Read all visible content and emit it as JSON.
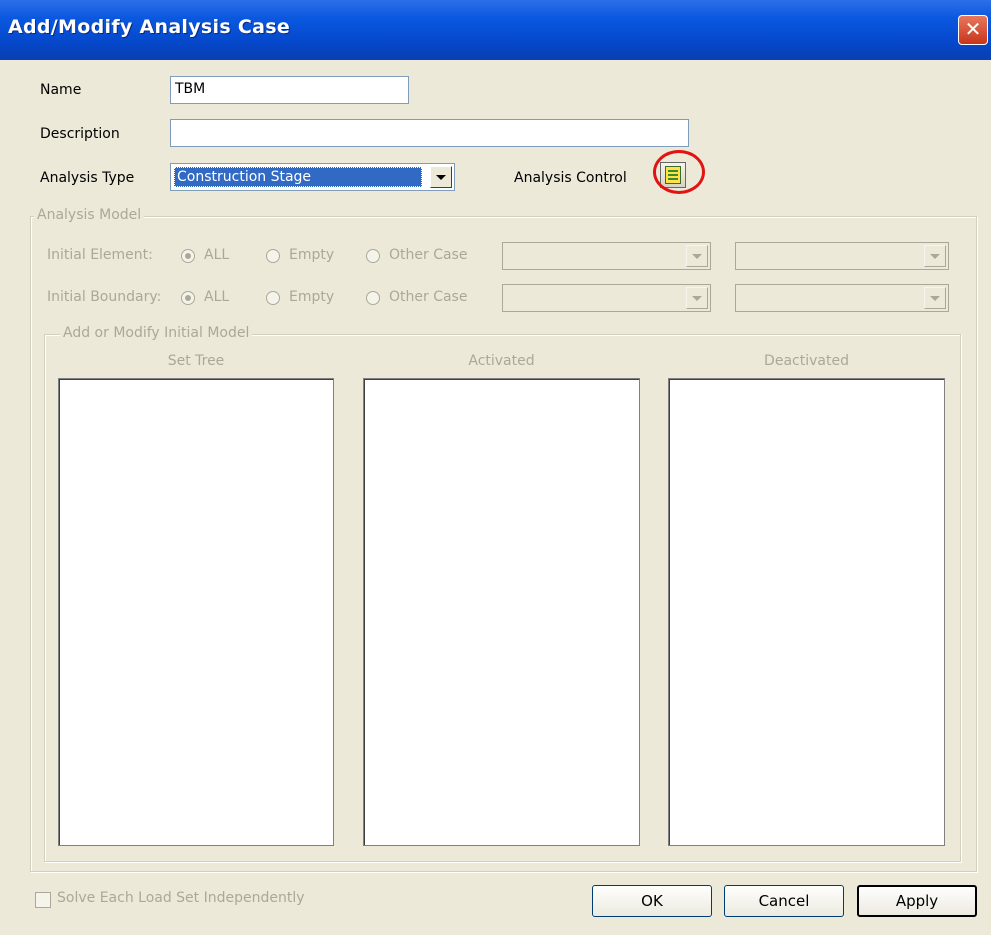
{
  "window": {
    "title": "Add/Modify Analysis Case",
    "close_glyph": "✕"
  },
  "form": {
    "name_label": "Name",
    "name_value": "TBM",
    "description_label": "Description",
    "description_value": "",
    "analysis_type_label": "Analysis Type",
    "analysis_type_value": "Construction Stage",
    "analysis_control_label": "Analysis Control",
    "analysis_control_icon": "table-sheet-icon"
  },
  "analysis_model": {
    "group_title": "Analysis Model",
    "initial_element_label": "Initial Element:",
    "initial_boundary_label": "Initial Boundary:",
    "option_all": "ALL",
    "option_empty": "Empty",
    "option_other_case": "Other Case",
    "initial_element_selected": "ALL",
    "initial_boundary_selected": "ALL"
  },
  "initial_model": {
    "group_title": "Add or Modify Initial Model",
    "columns": [
      "Set Tree",
      "Activated",
      "Deactivated"
    ]
  },
  "footer": {
    "solve_independently_label": "Solve Each Load Set Independently",
    "solve_independently_checked": false,
    "ok_label": "OK",
    "cancel_label": "Cancel",
    "apply_label": "Apply"
  },
  "colors": {
    "title_bar": "#0a58e0",
    "dialog_bg": "#ece9d8",
    "selection": "#316ac5",
    "highlight_ring": "#e21313",
    "disabled_text": "#aca899"
  }
}
